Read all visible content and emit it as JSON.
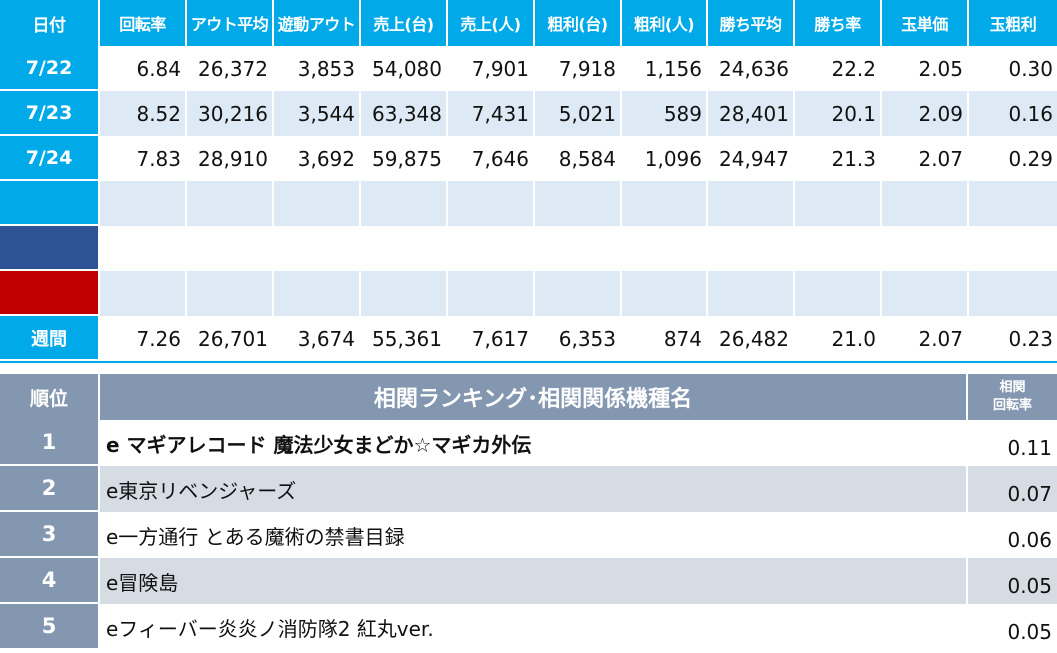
{
  "stats": {
    "headers": [
      "日付",
      "回転率",
      "アウト平均",
      "遊動アウト",
      "売上(台)",
      "売上(人)",
      "粗利(台)",
      "粗利(人)",
      "勝ち平均",
      "勝ち率",
      "玉単価",
      "玉粗利"
    ],
    "rows": [
      {
        "date": "7/22",
        "values": [
          "6.84",
          "26,372",
          "3,853",
          "54,080",
          "7,901",
          "7,918",
          "1,156",
          "24,636",
          "22.2",
          "2.05",
          "0.30"
        ]
      },
      {
        "date": "7/23",
        "values": [
          "8.52",
          "30,216",
          "3,544",
          "63,348",
          "7,431",
          "5,021",
          "589",
          "28,401",
          "20.1",
          "2.09",
          "0.16"
        ]
      },
      {
        "date": "7/24",
        "values": [
          "7.83",
          "28,910",
          "3,692",
          "59,875",
          "7,646",
          "8,584",
          "1,096",
          "24,947",
          "21.3",
          "2.07",
          "0.29"
        ]
      }
    ],
    "total": {
      "label": "週間",
      "values": [
        "7.26",
        "26,701",
        "3,674",
        "55,361",
        "7,617",
        "6,353",
        "874",
        "26,482",
        "21.0",
        "2.07",
        "0.23"
      ]
    },
    "swatch_colors": {
      "blue": "#2f5496",
      "red": "#c00000",
      "accent": "#00a9e8"
    }
  },
  "ranking": {
    "rank_header": "順位",
    "title": "相関ランキング･相関関係機種名",
    "metric_header_line1": "相関",
    "metric_header_line2": "回転率",
    "items": [
      {
        "rank": "1",
        "name": "e マギアレコード 魔法少女まどか☆マギカ外伝",
        "value": "0.11"
      },
      {
        "rank": "2",
        "name": "e東京リベンジャーズ",
        "value": "0.07"
      },
      {
        "rank": "3",
        "name": "e一方通行 とある魔術の禁書目録",
        "value": "0.06"
      },
      {
        "rank": "4",
        "name": "e冒険島",
        "value": "0.05"
      },
      {
        "rank": "5",
        "name": "eフィーバー炎炎ノ消防隊2 紅丸ver.",
        "value": "0.05"
      }
    ]
  }
}
